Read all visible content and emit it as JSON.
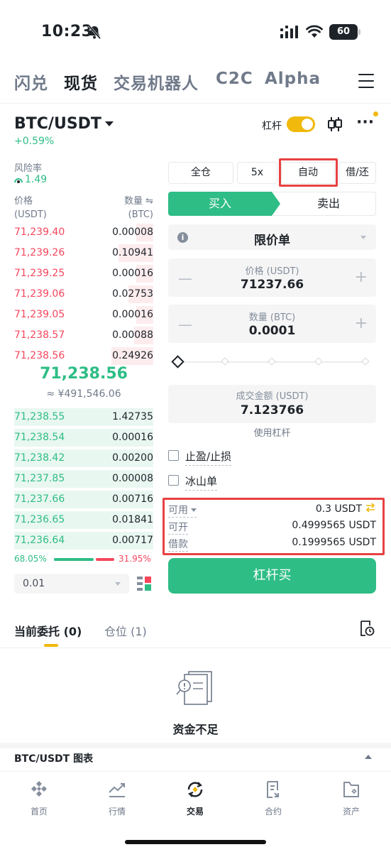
{
  "status_bar": {
    "time": "10:23",
    "battery": "60"
  },
  "top_tabs": [
    {
      "label": "闪兑",
      "active": false
    },
    {
      "label": "现货",
      "active": true
    },
    {
      "label": "交易机器人",
      "active": false
    },
    {
      "label": "C2C",
      "active": false
    },
    {
      "label": "Alpha",
      "active": false
    }
  ],
  "pair": {
    "symbol": "BTC/USDT",
    "change": "+0.59%",
    "leverage_label": "杠杆",
    "leverage_enabled": true
  },
  "risk": {
    "label": "风险率",
    "value": "1.49"
  },
  "order_book": {
    "price_header": [
      "价格",
      "(USDT)"
    ],
    "qty_header": [
      "数量 ⇋",
      "(BTC)"
    ],
    "asks": [
      {
        "price": "71,239.40",
        "qty": "0.00008",
        "depth": 0.12
      },
      {
        "price": "71,239.26",
        "qty": "0.10941",
        "depth": 0.25
      },
      {
        "price": "71,239.25",
        "qty": "0.00016",
        "depth": 0.12
      },
      {
        "price": "71,239.06",
        "qty": "0.02753",
        "depth": 0.18
      },
      {
        "price": "71,239.05",
        "qty": "0.00016",
        "depth": 0.12
      },
      {
        "price": "71,238.57",
        "qty": "0.00088",
        "depth": 0.14
      },
      {
        "price": "71,238.56",
        "qty": "0.24926",
        "depth": 0.3
      }
    ],
    "mid_price": "71,238.56",
    "mid_fiat": "≈ ¥491,546.06",
    "bids": [
      {
        "price": "71,238.55",
        "qty": "1.42735",
        "depth": 1.0
      },
      {
        "price": "71,238.54",
        "qty": "0.00016",
        "depth": 1.0
      },
      {
        "price": "71,238.42",
        "qty": "0.00200",
        "depth": 1.0
      },
      {
        "price": "71,237.85",
        "qty": "0.00008",
        "depth": 1.0
      },
      {
        "price": "71,237.66",
        "qty": "0.00716",
        "depth": 1.0
      },
      {
        "price": "71,236.65",
        "qty": "0.01841",
        "depth": 1.0
      },
      {
        "price": "71,236.64",
        "qty": "0.00717",
        "depth": 1.0
      }
    ],
    "buy_ratio": "68.05%",
    "sell_ratio": "31.95%",
    "precision": "0.01"
  },
  "margin_modes": {
    "cross": "全仓",
    "leverage": "5x",
    "auto": "自动",
    "borrow_repay": "借/还"
  },
  "side_tabs": {
    "buy": "买入",
    "sell": "卖出"
  },
  "order_type": "限价单",
  "price_field": {
    "label": "价格 (USDT)",
    "value": "71237.66"
  },
  "qty_field": {
    "label": "数量 (BTC)",
    "value": "0.0001"
  },
  "slider_percent": 0,
  "total_field": {
    "label": "成交金额 (USDT)",
    "value": "7.123766"
  },
  "use_leverage": "使用杠杆",
  "tp_sl": "止盈/止损",
  "iceberg": "冰山单",
  "balances": {
    "available_label": "可用",
    "available_value": "0.3 USDT",
    "openable_label": "可开",
    "openable_value": "0.4999565 USDT",
    "borrow_label": "借款",
    "borrow_value": "0.1999565 USDT"
  },
  "action_button": "杠杆买",
  "order_tabs": {
    "open_orders": "当前委托 (0)",
    "positions": "仓位 (1)"
  },
  "empty_state": "资金不足",
  "chart_bar": "BTC/USDT 图表",
  "bottom_nav": [
    {
      "label": "首页",
      "icon": "home-icon",
      "active": false
    },
    {
      "label": "行情",
      "icon": "markets-icon",
      "active": false
    },
    {
      "label": "交易",
      "icon": "trade-icon",
      "active": true
    },
    {
      "label": "合约",
      "icon": "futures-icon",
      "active": false
    },
    {
      "label": "资产",
      "icon": "wallet-icon",
      "active": false
    }
  ],
  "colors": {
    "buy": "#2ebd85",
    "sell": "#f6465d",
    "accent": "#f0b90b",
    "highlight": "#e84142"
  }
}
